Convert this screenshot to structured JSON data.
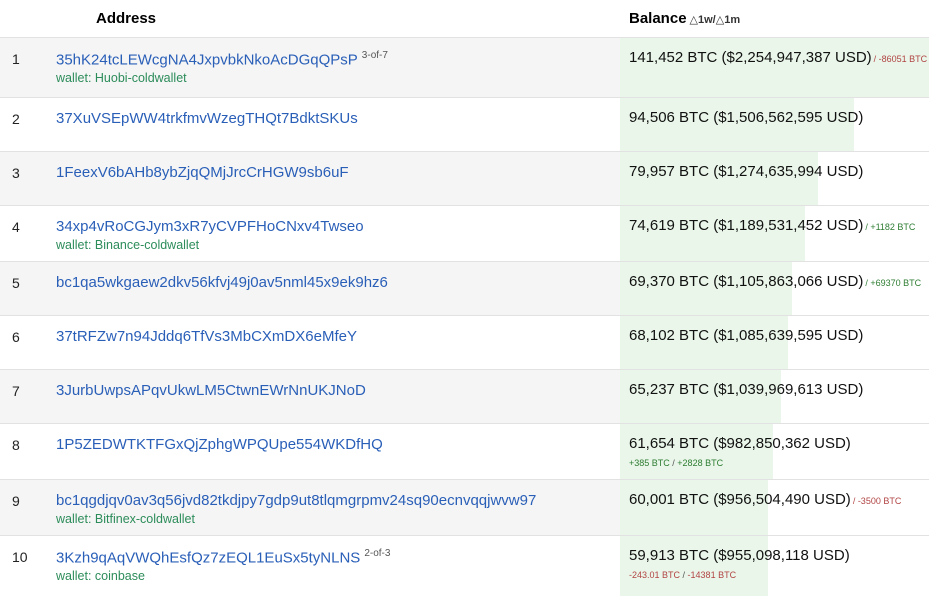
{
  "header": {
    "address": "Address",
    "balance": "Balance",
    "delta": "△1w/△1m"
  },
  "colors": {
    "link": "#2a5fb8",
    "wallet": "#2c8c5a",
    "negative": "#b24444",
    "positive": "#2e7d32",
    "bar": "#e9f6e9"
  },
  "rows": [
    {
      "rank": "1",
      "address": "35hK24tcLEWcgNA4JxpvbkNkoAcDGqQPsP",
      "sig": "3-of-7",
      "wallet": "wallet: Huobi-coldwallet",
      "balance": "141,452 BTC ($2,254,947,387 USD)",
      "share": 1.0,
      "chg_inline": [
        {
          "text": "/ -86051 BTC",
          "tone": "neg"
        }
      ],
      "chg_line": []
    },
    {
      "rank": "2",
      "address": "37XuVSEpWW4trkfmvWzegTHQt7BdktSKUs",
      "sig": "",
      "wallet": "",
      "balance": "94,506 BTC ($1,506,562,595 USD)",
      "share": 0.668,
      "chg_inline": [],
      "chg_line": []
    },
    {
      "rank": "3",
      "address": "1FeexV6bAHb8ybZjqQMjJrcCrHGW9sb6uF",
      "sig": "",
      "wallet": "",
      "balance": "79,957 BTC ($1,274,635,994 USD)",
      "share": 0.565,
      "chg_inline": [],
      "chg_line": []
    },
    {
      "rank": "4",
      "address": "34xp4vRoCGJym3xR7yCVPFHoCNxv4Twseo",
      "sig": "",
      "wallet": "wallet: Binance-coldwallet",
      "balance": "74,619 BTC ($1,189,531,452 USD)",
      "share": 0.528,
      "chg_inline": [
        {
          "text": "/ +1182 BTC",
          "tone": "pos"
        }
      ],
      "chg_line": []
    },
    {
      "rank": "5",
      "address": "bc1qa5wkgaew2dkv56kfvj49j0av5nml45x9ek9hz6",
      "sig": "",
      "wallet": "",
      "balance": "69,370 BTC ($1,105,863,066 USD)",
      "share": 0.49,
      "chg_inline": [
        {
          "text": "/ +69370 BTC",
          "tone": "pos"
        }
      ],
      "chg_line": []
    },
    {
      "rank": "6",
      "address": "37tRFZw7n94Jddq6TfVs3MbCXmDX6eMfeY",
      "sig": "",
      "wallet": "",
      "balance": "68,102 BTC ($1,085,639,595 USD)",
      "share": 0.481,
      "chg_inline": [],
      "chg_line": []
    },
    {
      "rank": "7",
      "address": "3JurbUwpsAPqvUkwLM5CtwnEWrNnUKJNoD",
      "sig": "",
      "wallet": "",
      "balance": "65,237 BTC ($1,039,969,613 USD)",
      "share": 0.461,
      "chg_inline": [],
      "chg_line": []
    },
    {
      "rank": "8",
      "address": "1P5ZEDWTKTFGxQjZphgWPQUpe554WKDfHQ",
      "sig": "",
      "wallet": "",
      "balance": "61,654 BTC ($982,850,362 USD)",
      "share": 0.436,
      "chg_inline": [],
      "chg_line": [
        {
          "text": "+385 BTC",
          "tone": "pos"
        },
        {
          "text": " / ",
          "tone": "sep"
        },
        {
          "text": "+2828 BTC",
          "tone": "pos"
        }
      ]
    },
    {
      "rank": "9",
      "address": "bc1qgdjqv0av3q56jvd82tkdjpy7gdp9ut8tlqmgrpmv24sq90ecnvqqjwvw97",
      "sig": "",
      "wallet": "wallet: Bitfinex-coldwallet",
      "balance": "60,001 BTC ($956,504,490 USD)",
      "share": 0.424,
      "chg_inline": [
        {
          "text": "/ -3500 BTC",
          "tone": "neg"
        }
      ],
      "chg_line": []
    },
    {
      "rank": "10",
      "address": "3Kzh9qAqVWQhEsfQz7zEQL1EuSx5tyNLNS",
      "sig": "2-of-3",
      "wallet": "wallet: coinbase",
      "balance": "59,913 BTC ($955,098,118 USD)",
      "share": 0.424,
      "chg_inline": [],
      "chg_line": [
        {
          "text": "-243.01 BTC",
          "tone": "neg"
        },
        {
          "text": " / ",
          "tone": "sep"
        },
        {
          "text": "-14381 BTC",
          "tone": "neg"
        }
      ]
    }
  ]
}
